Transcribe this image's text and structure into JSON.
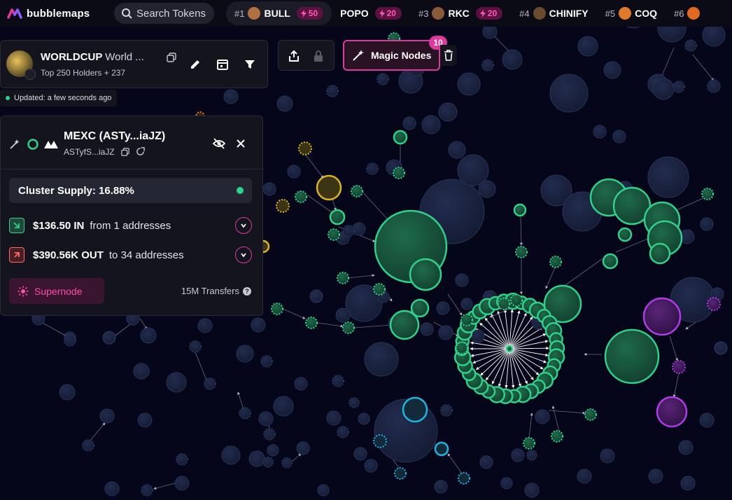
{
  "app": {
    "name": "bubblemaps"
  },
  "search": {
    "label": "Search Tokens"
  },
  "ticker": [
    {
      "rank": "#1",
      "name": "BULL",
      "boost": "50",
      "avatar_color": "#b07040"
    },
    {
      "rank": "",
      "name": "POPO",
      "boost": "20",
      "avatar_color": ""
    },
    {
      "rank": "#3",
      "name": "RKC",
      "boost": "20",
      "avatar_color": "#8a5a3a"
    },
    {
      "rank": "#4",
      "name": "CHINIFY",
      "boost": "",
      "avatar_color": "#6a4a30"
    },
    {
      "rank": "#5",
      "name": "COQ",
      "boost": "",
      "avatar_color": "#e07a2a"
    },
    {
      "rank": "#6",
      "name": "",
      "boost": "",
      "avatar_color": "#e06a20"
    }
  ],
  "token": {
    "symbol": "WORLDCUP",
    "name_truncated": "World ...",
    "holders": "Top 250 Holders + 237"
  },
  "updated": "Updated: a few seconds ago",
  "magic_nodes": {
    "label": "Magic Nodes",
    "count": "10"
  },
  "cluster": {
    "title": "MEXC (ASTy...iaJZ)",
    "address": "ASTyfS...iaJZ",
    "supply": "Cluster Supply: 16.88%",
    "in_amount": "$136.50 IN",
    "in_text": "from 1 addresses",
    "out_amount": "$390.56K OUT",
    "out_text": "to 34 addresses",
    "supernode": "Supernode",
    "transfers": "15M Transfers"
  },
  "colors": {
    "accent": "#e0399d",
    "green": "#2fd28a",
    "yellow": "#d9b52a",
    "purple": "#b13be6",
    "cyan": "#1fb6e0",
    "bubble": "#1a2240"
  }
}
